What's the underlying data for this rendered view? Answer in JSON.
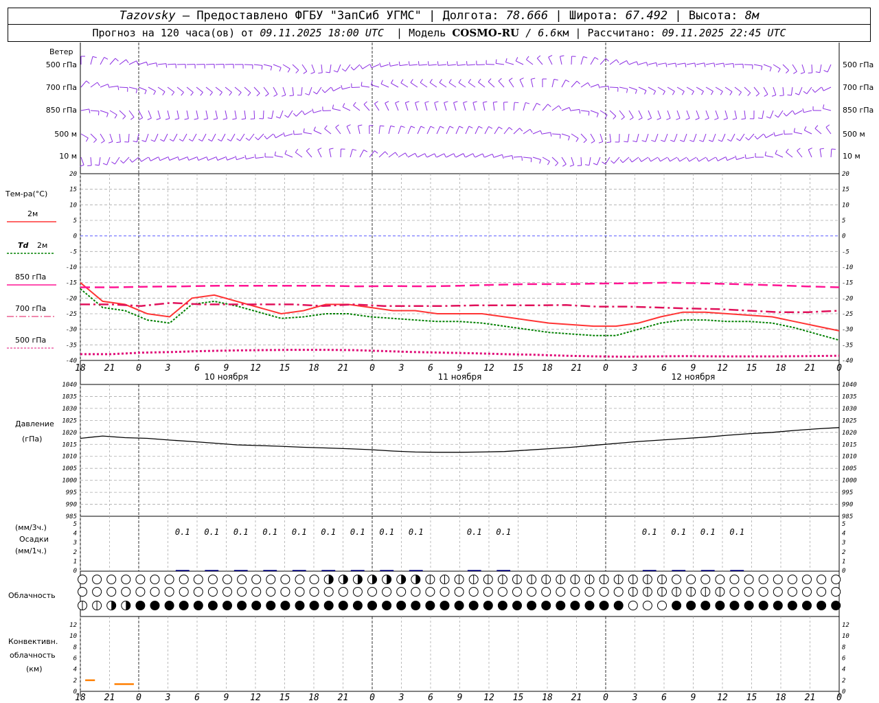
{
  "header": {
    "station": "Tazovsky",
    "provider": "– Предоставлено ФГБУ \"ЗапСиб УГМС\"",
    "lon_label": "Долгота:",
    "lon": "78.666",
    "lat_label": "Широта:",
    "lat": "67.492",
    "alt_label": "Высота:",
    "alt": "8м",
    "forecast_prefix": "Прогноз на 120 часа(ов) от",
    "forecast_start": "09.11.2025 18:00 UTC",
    "model_label": "Модель",
    "model": "COSMO-RU",
    "resolution": "/ 6.6",
    "resolution_unit": "км",
    "computed_label": "Рассчитано:",
    "computed": "09.11.2025 22:45 UTC"
  },
  "labels": {
    "wind": "Ветер",
    "wind_levels": [
      "500 гПа",
      "700 гПа",
      "850 гПа",
      "500 м",
      "10 м"
    ],
    "temp": "Тем-ра(°C)",
    "t2m": "2м",
    "td": "Td",
    "td2m": "2м",
    "t850": "850 гПа",
    "t700": "700 гПа",
    "t500": "500 гПа",
    "pressure": "Давление",
    "pressure_unit": "(гПа)",
    "precip_3h": "(мм/3ч.)",
    "precip": "Осадки",
    "precip_1h": "(мм/1ч.)",
    "cloud": "Облачность",
    "conv1": "Конвективн.",
    "conv2": "облачность",
    "conv3": "(км)"
  },
  "colors": {
    "wind": "#8a2be2",
    "t2m": "#ff3333",
    "td2m": "#008000",
    "t850": "#ff1493",
    "t700": "#e0105a",
    "t500": "#e0107a",
    "pressure": "#000000",
    "precip": "#00008b",
    "conv": "#ff7f00",
    "zero_line": "#4444ff"
  },
  "x_axis": {
    "ticks": [
      "18",
      "21",
      "0",
      "3",
      "6",
      "9",
      "12",
      "15",
      "18",
      "21",
      "0",
      "3",
      "6",
      "9",
      "12",
      "15",
      "18",
      "21",
      "0",
      "3",
      "6",
      "9",
      "12",
      "15",
      "18",
      "21",
      "0"
    ],
    "dates": [
      "10 ноября",
      "11 ноября",
      "12 ноября"
    ]
  },
  "chart_data": [
    {
      "type": "line",
      "title": "Тем-ра(°C)",
      "x_hours": [
        0,
        3,
        6,
        9,
        12,
        15,
        18,
        21,
        24,
        27,
        30,
        33,
        36,
        39,
        42,
        45,
        48,
        51,
        54,
        57,
        60,
        63,
        66,
        69,
        72,
        75,
        78
      ],
      "ylim": [
        -40,
        20
      ],
      "yticks": [
        20,
        15,
        10,
        5,
        0,
        -5,
        -10,
        -15,
        -20,
        -25,
        -30,
        -35,
        -40
      ],
      "series": [
        {
          "name": "2м",
          "values": [
            -15,
            -21,
            -22,
            -25,
            -26,
            -20,
            -19,
            -21,
            -23,
            -25,
            -24,
            -22,
            -22,
            -23,
            -24,
            -24,
            -25,
            -25,
            -25,
            -26,
            -27,
            -28,
            -28.5,
            -29,
            -29,
            -28,
            -26,
            -24.5,
            -24.5,
            -25,
            -25.5,
            -26,
            -27.5,
            -29,
            -30.5
          ]
        },
        {
          "name": "Td 2м",
          "values": [
            -17,
            -23,
            -24,
            -27,
            -28,
            -22,
            -21,
            -22.5,
            -24.5,
            -26.5,
            -26,
            -25,
            -25,
            -26,
            -26.5,
            -27,
            -27.5,
            -27.5,
            -28,
            -29,
            -30,
            -31,
            -31.5,
            -32,
            -32,
            -30,
            -28,
            -27,
            -27,
            -27.5,
            -27.5,
            -28,
            -29.5,
            -31.5,
            -33.5
          ]
        },
        {
          "name": "850 гПа",
          "values": [
            -16.5,
            -16.5,
            -16.3,
            -16.2,
            -16,
            -16,
            -16,
            -16,
            -16.2,
            -16.1,
            -16.2,
            -16,
            -15.7,
            -15.5,
            -15.5,
            -15.3,
            -15.2,
            -15,
            -15.2,
            -15.5,
            -15.8,
            -16.2,
            -16.5
          ]
        },
        {
          "name": "700 гПа",
          "values": [
            -22,
            -22,
            -22.5,
            -21.5,
            -22,
            -22,
            -22,
            -22,
            -22.5,
            -22,
            -22.5,
            -22.5,
            -22.5,
            -22.3,
            -22.3,
            -22.3,
            -22.2,
            -22.7,
            -22.7,
            -23,
            -23.3,
            -23.5,
            -24,
            -24.5,
            -24.5,
            -24
          ]
        },
        {
          "name": "500 гПа",
          "values": [
            -38,
            -38,
            -37.5,
            -37.3,
            -37,
            -36.8,
            -36.7,
            -36.6,
            -36.6,
            -36.7,
            -37,
            -37.3,
            -37.5,
            -37.7,
            -38,
            -38.2,
            -38.5,
            -38.7,
            -38.8,
            -38.7,
            -38.6,
            -38.7,
            -38.7,
            -38.7,
            -38.6,
            -38.5
          ]
        }
      ]
    },
    {
      "type": "line",
      "title": "Давление",
      "ylabel": "(гПа)",
      "ylim": [
        985,
        1040
      ],
      "yticks": [
        1040,
        1035,
        1030,
        1025,
        1020,
        1015,
        1010,
        1005,
        1000,
        995,
        990,
        985
      ],
      "series": [
        {
          "name": "Давление",
          "values": [
            1017.5,
            1018.5,
            1017.8,
            1017.5,
            1016.8,
            1016.2,
            1015.5,
            1014.8,
            1014.5,
            1014.2,
            1013.8,
            1013.5,
            1013.2,
            1012.8,
            1012.2,
            1011.8,
            1011.7,
            1011.7,
            1011.8,
            1012.0,
            1012.6,
            1013.2,
            1013.8,
            1014.6,
            1015.4,
            1016.2,
            1016.8,
            1017.4,
            1018.0,
            1018.8,
            1019.5,
            1020.0,
            1020.8,
            1021.5,
            1022.0
          ]
        }
      ]
    },
    {
      "type": "bar",
      "title": "Осадки",
      "ylim": [
        0,
        5
      ],
      "yticks": [
        5,
        4,
        3,
        2,
        1,
        0
      ],
      "labels_3h": [
        {
          "hour": 12,
          "value": "0.1"
        },
        {
          "hour": 15,
          "value": "0.1"
        },
        {
          "hour": 18,
          "value": "0.1"
        },
        {
          "hour": 21,
          "value": "0.1"
        },
        {
          "hour": 24,
          "value": "0.1"
        },
        {
          "hour": 27,
          "value": "0.1"
        },
        {
          "hour": 30,
          "value": "0.1"
        },
        {
          "hour": 33,
          "value": "0.1"
        },
        {
          "hour": 36,
          "value": "0.1"
        },
        {
          "hour": 42,
          "value": "0.1"
        },
        {
          "hour": 45,
          "value": "0.1"
        },
        {
          "hour": 60,
          "value": "0.1"
        },
        {
          "hour": 63,
          "value": "0.1"
        },
        {
          "hour": 66,
          "value": "0.1"
        },
        {
          "hour": 69,
          "value": "0.1"
        }
      ]
    },
    {
      "type": "bar",
      "title": "Конвективн. облачность (км)",
      "ylim": [
        0,
        13
      ],
      "yticks": [
        12,
        10,
        8,
        6,
        4,
        2,
        0
      ],
      "segments": [
        {
          "from_hour": 0.5,
          "to_hour": 1.5,
          "value": 2
        },
        {
          "from_hour": 3.5,
          "to_hour": 5.5,
          "value": 1.3
        }
      ]
    }
  ],
  "clouds": {
    "rows": 3,
    "count": 53
  }
}
